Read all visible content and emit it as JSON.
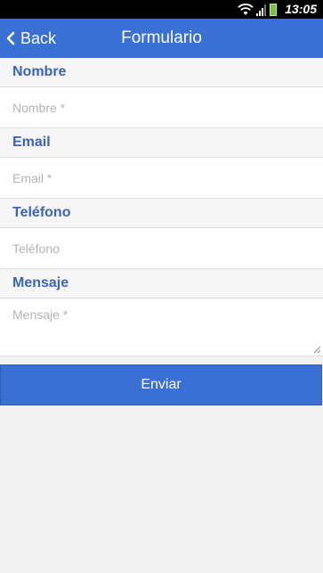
{
  "status_bar": {
    "time": "13:05",
    "icons": [
      "wifi-icon",
      "signal-icon",
      "battery-icon"
    ],
    "battery_color": "#7cc043"
  },
  "nav": {
    "back_label": "Back",
    "title": "Formulario",
    "color": "#3a6fd4"
  },
  "form": {
    "nombre": {
      "label": "Nombre",
      "placeholder": "Nombre *",
      "value": ""
    },
    "email": {
      "label": "Email",
      "placeholder": "Email *",
      "value": ""
    },
    "telefono": {
      "label": "Teléfono",
      "placeholder": "Teléfono",
      "value": ""
    },
    "mensaje": {
      "label": "Mensaje",
      "placeholder": "Mensaje *",
      "value": ""
    },
    "label_color": "#3a64b8"
  },
  "submit": {
    "label": "Enviar"
  }
}
